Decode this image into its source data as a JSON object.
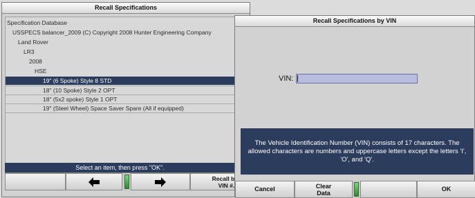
{
  "back_window": {
    "title": "Recall Specifications",
    "tree": [
      {
        "text": "Specification Database",
        "level": 0
      },
      {
        "text": "USSPECS balancer_2009 (C) Copyright 2008 Hunter Engineering Company",
        "level": 1
      },
      {
        "text": "Land Rover",
        "level": 2
      },
      {
        "text": "LR3",
        "level": 3
      },
      {
        "text": "2008",
        "level": 4
      },
      {
        "text": "HSE",
        "level": 5
      },
      {
        "text": "19\" (6 Spoke) Style 8 STD",
        "level": 6,
        "selected": true
      },
      {
        "text": "18\" (10 Spoke) Style 2 OPT",
        "level": 6
      },
      {
        "text": "18\" (5x2 spoke) Style 1 OPT",
        "level": 6
      },
      {
        "text": "19\" (Steel Wheel) Space Saver Spare (All if equipped)",
        "level": 6
      }
    ],
    "status": "Select an item, then press \"OK\".",
    "buttons": {
      "left_icon": "left-arrow-icon",
      "right_icon": "right-arrow-icon",
      "recall_line1": "Recall by",
      "recall_line2": "VIN #..."
    }
  },
  "front_window": {
    "title": "Recall Specifications by VIN",
    "vin_label": "VIN:",
    "vin_value": "",
    "info_text": "The Vehicle Identification Number (VIN) consists of 17 characters. The allowed characters are numbers and uppercase letters except the letters 'I', 'O', and 'Q'.",
    "buttons": {
      "cancel": "Cancel",
      "clear_line1": "Clear",
      "clear_line2": "Data",
      "ok": "OK"
    }
  },
  "colors": {
    "selection": "#2c3c5c",
    "panel": "#d2d2d2",
    "input": "#b9bddf",
    "grip": "#3fb03f"
  }
}
